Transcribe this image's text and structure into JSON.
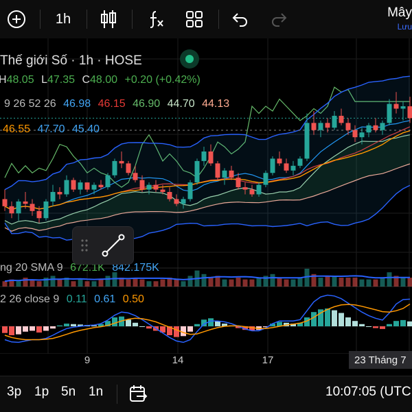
{
  "toolbar": {
    "interval": "1h",
    "cloud_title": "Mây",
    "cloud_sub": "Lưu"
  },
  "legend": {
    "symbol_line": "Thế giới Số · 1h · HOSE",
    "ohlc": {
      "h_label": "H",
      "h": "48.05",
      "l_label": "L",
      "l": "47.35",
      "c_label": "C",
      "c": "48.00",
      "change": "+0.20 (+0.42%)"
    },
    "ichimoku": {
      "params": "9 26 52 26",
      "v1": "46.98",
      "v2": "46.15",
      "v3": "46.90",
      "v4": "44.70",
      "v5": "44.13"
    },
    "bb": {
      "v1": "46.55",
      "v2": "47.70",
      "v3": "45.40"
    },
    "volume": {
      "label": "ng 20 SMA 9",
      "v1": "672.1K",
      "v2": "842.175K"
    },
    "macd": {
      "label": "2 26 close 9",
      "v1": "0.11",
      "v2": "0.61",
      "v3": "0.50"
    }
  },
  "time_axis": [
    "9",
    "14",
    "17"
  ],
  "time_axis_highlight": "23 Tháng 7",
  "bottom": {
    "ranges": [
      "3p",
      "1p",
      "5n",
      "1n"
    ],
    "clock": "10:07:05 (UTC"
  },
  "colors": {
    "up": "#26a69a",
    "down": "#ef5350",
    "bb_line": "#2962ff",
    "conversion": "#2196f3",
    "base": "#e53935",
    "lagging": "#66bb6a",
    "ma": "#ff9800",
    "green_text": "#4caf50",
    "blue_text": "#42a5f5",
    "red_text": "#ef5350",
    "salmon_text": "#ffab91"
  },
  "chart_data": {
    "type": "candlestick",
    "candles_ohlc": [
      [
        44.6,
        45.0,
        44.1,
        44.3
      ],
      [
        44.3,
        44.5,
        43.8,
        44.0
      ],
      [
        44.0,
        44.6,
        43.7,
        44.5
      ],
      [
        44.5,
        44.9,
        44.2,
        44.4
      ],
      [
        44.4,
        44.6,
        43.9,
        44.1
      ],
      [
        44.1,
        44.3,
        43.6,
        43.8
      ],
      [
        43.8,
        44.6,
        43.7,
        44.5
      ],
      [
        44.5,
        45.2,
        44.3,
        44.9
      ],
      [
        44.9,
        45.1,
        44.6,
        44.8
      ],
      [
        44.8,
        45.6,
        44.7,
        45.4
      ],
      [
        45.4,
        45.5,
        44.9,
        45.0
      ],
      [
        45.0,
        45.4,
        44.8,
        45.3
      ],
      [
        45.3,
        45.3,
        44.9,
        45.0
      ],
      [
        45.0,
        45.3,
        44.8,
        45.2
      ],
      [
        45.2,
        45.4,
        45.0,
        45.1
      ],
      [
        45.1,
        45.7,
        45.0,
        45.6
      ],
      [
        45.6,
        46.3,
        45.5,
        46.2
      ],
      [
        46.2,
        46.6,
        45.9,
        46.1
      ],
      [
        46.1,
        46.2,
        45.6,
        45.7
      ],
      [
        45.7,
        46.0,
        45.3,
        45.4
      ],
      [
        45.4,
        45.6,
        44.9,
        45.0
      ],
      [
        45.0,
        45.3,
        44.8,
        45.2
      ],
      [
        45.2,
        45.4,
        44.9,
        45.0
      ],
      [
        45.0,
        45.2,
        44.8,
        44.9
      ],
      [
        44.9,
        45.1,
        44.5,
        44.6
      ],
      [
        44.6,
        44.8,
        44.3,
        44.4
      ],
      [
        44.4,
        44.7,
        44.2,
        44.6
      ],
      [
        44.6,
        45.4,
        44.5,
        45.3
      ],
      [
        45.3,
        46.3,
        45.2,
        46.2
      ],
      [
        46.2,
        46.8,
        46.0,
        46.6
      ],
      [
        46.6,
        46.9,
        46.0,
        46.1
      ],
      [
        46.1,
        46.2,
        45.4,
        45.5
      ],
      [
        45.5,
        45.9,
        45.2,
        45.8
      ],
      [
        45.8,
        46.0,
        45.4,
        45.5
      ],
      [
        45.5,
        45.7,
        45.0,
        45.1
      ],
      [
        45.1,
        45.3,
        44.8,
        45.0
      ],
      [
        45.0,
        45.2,
        44.7,
        44.8
      ],
      [
        44.8,
        45.3,
        44.7,
        45.2
      ],
      [
        45.2,
        45.8,
        45.1,
        45.7
      ],
      [
        45.7,
        46.4,
        45.6,
        46.3
      ],
      [
        46.3,
        46.6,
        46.0,
        46.1
      ],
      [
        46.1,
        46.3,
        45.7,
        45.8
      ],
      [
        45.8,
        46.2,
        45.6,
        46.0
      ],
      [
        46.0,
        46.4,
        45.9,
        46.3
      ],
      [
        46.3,
        48.2,
        46.2,
        47.8
      ],
      [
        47.8,
        48.3,
        47.3,
        47.5
      ],
      [
        47.5,
        47.9,
        47.2,
        47.8
      ],
      [
        47.8,
        48.0,
        47.4,
        47.6
      ],
      [
        47.6,
        48.3,
        47.5,
        48.1
      ],
      [
        48.1,
        48.4,
        47.7,
        47.8
      ],
      [
        47.8,
        48.0,
        47.3,
        47.5
      ],
      [
        47.5,
        47.7,
        47.0,
        47.2
      ],
      [
        47.2,
        47.6,
        46.9,
        47.4
      ],
      [
        47.4,
        47.8,
        47.2,
        47.7
      ],
      [
        47.7,
        48.0,
        47.4,
        47.5
      ],
      [
        47.5,
        47.9,
        47.3,
        47.8
      ],
      [
        47.8,
        48.8,
        47.7,
        48.6
      ],
      [
        48.6,
        49.1,
        48.2,
        48.4
      ],
      [
        48.4,
        48.7,
        47.9,
        48.5
      ],
      [
        48.5,
        48.9,
        47.8,
        48.0
      ]
    ],
    "volume": [
      0.3,
      0.4,
      0.3,
      0.5,
      0.4,
      0.3,
      0.5,
      0.6,
      0.4,
      0.5,
      0.3,
      0.4,
      0.3,
      0.3,
      0.4,
      0.6,
      0.8,
      0.5,
      0.4,
      0.5,
      0.4,
      0.3,
      0.3,
      0.4,
      0.5,
      0.4,
      0.3,
      0.6,
      0.9,
      0.7,
      0.5,
      0.6,
      0.4,
      0.4,
      0.5,
      0.4,
      0.4,
      0.5,
      0.6,
      0.7,
      0.5,
      0.4,
      0.4,
      0.5,
      1.0,
      0.7,
      0.5,
      0.6,
      0.6,
      0.5,
      0.5,
      0.5,
      0.4,
      0.4,
      0.4,
      0.5,
      0.8,
      0.6,
      0.5,
      0.5
    ],
    "macd_hist": [
      -0.15,
      -0.2,
      -0.18,
      -0.12,
      -0.1,
      -0.14,
      -0.1,
      -0.05,
      0.02,
      0.06,
      0.05,
      0.04,
      0.03,
      0.02,
      0.05,
      0.12,
      0.2,
      0.22,
      0.15,
      0.08,
      0.0,
      -0.05,
      -0.1,
      -0.14,
      -0.2,
      -0.24,
      -0.22,
      -0.12,
      0.05,
      0.15,
      0.18,
      0.12,
      0.06,
      0.02,
      -0.04,
      -0.08,
      -0.1,
      -0.08,
      -0.02,
      0.06,
      0.1,
      0.08,
      0.06,
      0.08,
      0.2,
      0.32,
      0.38,
      0.4,
      0.36,
      0.3,
      0.2,
      0.12,
      0.05,
      0.0,
      -0.04,
      -0.06,
      0.05,
      0.12,
      0.14,
      0.11
    ],
    "macd_line": [
      -0.3,
      -0.35,
      -0.36,
      -0.33,
      -0.3,
      -0.3,
      -0.27,
      -0.2,
      -0.12,
      -0.05,
      -0.02,
      0.0,
      0.02,
      0.03,
      0.06,
      0.14,
      0.25,
      0.32,
      0.3,
      0.24,
      0.15,
      0.05,
      -0.05,
      -0.15,
      -0.25,
      -0.33,
      -0.36,
      -0.3,
      -0.12,
      0.05,
      0.12,
      0.12,
      0.1,
      0.06,
      0.0,
      -0.06,
      -0.1,
      -0.1,
      -0.04,
      0.06,
      0.12,
      0.12,
      0.12,
      0.15,
      0.35,
      0.55,
      0.66,
      0.7,
      0.68,
      0.62,
      0.52,
      0.42,
      0.32,
      0.24,
      0.18,
      0.14,
      0.3,
      0.5,
      0.6,
      0.61
    ],
    "signal_line": [
      -0.2,
      -0.25,
      -0.28,
      -0.3,
      -0.3,
      -0.3,
      -0.29,
      -0.27,
      -0.23,
      -0.18,
      -0.13,
      -0.09,
      -0.06,
      -0.03,
      -0.01,
      0.02,
      0.07,
      0.12,
      0.16,
      0.18,
      0.17,
      0.14,
      0.1,
      0.04,
      -0.02,
      -0.08,
      -0.14,
      -0.18,
      -0.17,
      -0.12,
      -0.07,
      -0.03,
      0.0,
      0.01,
      0.01,
      -0.01,
      -0.03,
      -0.05,
      -0.05,
      -0.03,
      0.0,
      0.03,
      0.05,
      0.07,
      0.12,
      0.2,
      0.3,
      0.38,
      0.44,
      0.48,
      0.49,
      0.48,
      0.45,
      0.41,
      0.37,
      0.33,
      0.32,
      0.35,
      0.4,
      0.5
    ],
    "price_range": [
      43.0,
      50.2
    ]
  }
}
